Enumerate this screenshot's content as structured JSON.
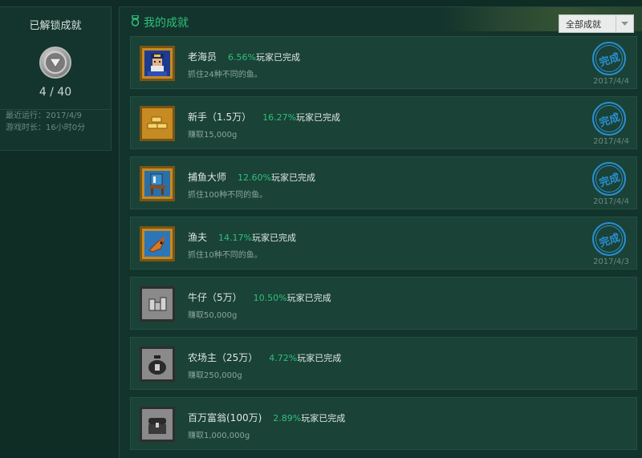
{
  "sidebar": {
    "title": "已解锁成就",
    "badge_icon": "down-triangle-medal-icon",
    "count": "4 / 40",
    "last_run": "最近运行：2017/4/9",
    "play_time": "游戏时长：16小时0分"
  },
  "header": {
    "title": "我的成就",
    "icon": "medal-icon",
    "filter_label": "全部成就"
  },
  "achievements": [
    {
      "name": "老海员",
      "pct": "6.56%",
      "pct_suffix": "玩家已完成",
      "desc": "抓住24种不同的鱼。",
      "done": true,
      "stamp": "完成",
      "date": "2017/4/4",
      "icon": "old-sailor-icon"
    },
    {
      "name": "新手（1.5万）",
      "pct": "16.27%",
      "pct_suffix": "玩家已完成",
      "desc": "赚取15,000g",
      "done": true,
      "stamp": "完成",
      "date": "2017/4/4",
      "icon": "gold-bars-icon"
    },
    {
      "name": "捕鱼大师",
      "pct": "12.60%",
      "pct_suffix": "玩家已完成",
      "desc": "抓住100种不同的鱼。",
      "done": true,
      "stamp": "完成",
      "date": "2017/4/4",
      "icon": "fishing-chair-icon"
    },
    {
      "name": "渔夫",
      "pct": "14.17%",
      "pct_suffix": "玩家已完成",
      "desc": "抓住10种不同的鱼。",
      "done": true,
      "stamp": "完成",
      "date": "2017/4/3",
      "icon": "fish-icon"
    },
    {
      "name": "牛仔（5万）",
      "pct": "10.50%",
      "pct_suffix": "玩家已完成",
      "desc": "赚取50,000g",
      "done": false,
      "icon": "coin-stacks-icon"
    },
    {
      "name": "农场主（25万）",
      "pct": "4.72%",
      "pct_suffix": "玩家已完成",
      "desc": "赚取250,000g",
      "done": false,
      "icon": "money-bag-icon"
    },
    {
      "name": "百万富翁(100万)",
      "pct": "2.89%",
      "pct_suffix": "玩家已完成",
      "desc": "赚取1,000,000g",
      "done": false,
      "icon": "treasure-chest-icon"
    }
  ],
  "colors": {
    "accent": "#2ec07a",
    "stamp": "#2a8fd0",
    "background": "#0f2c25"
  }
}
